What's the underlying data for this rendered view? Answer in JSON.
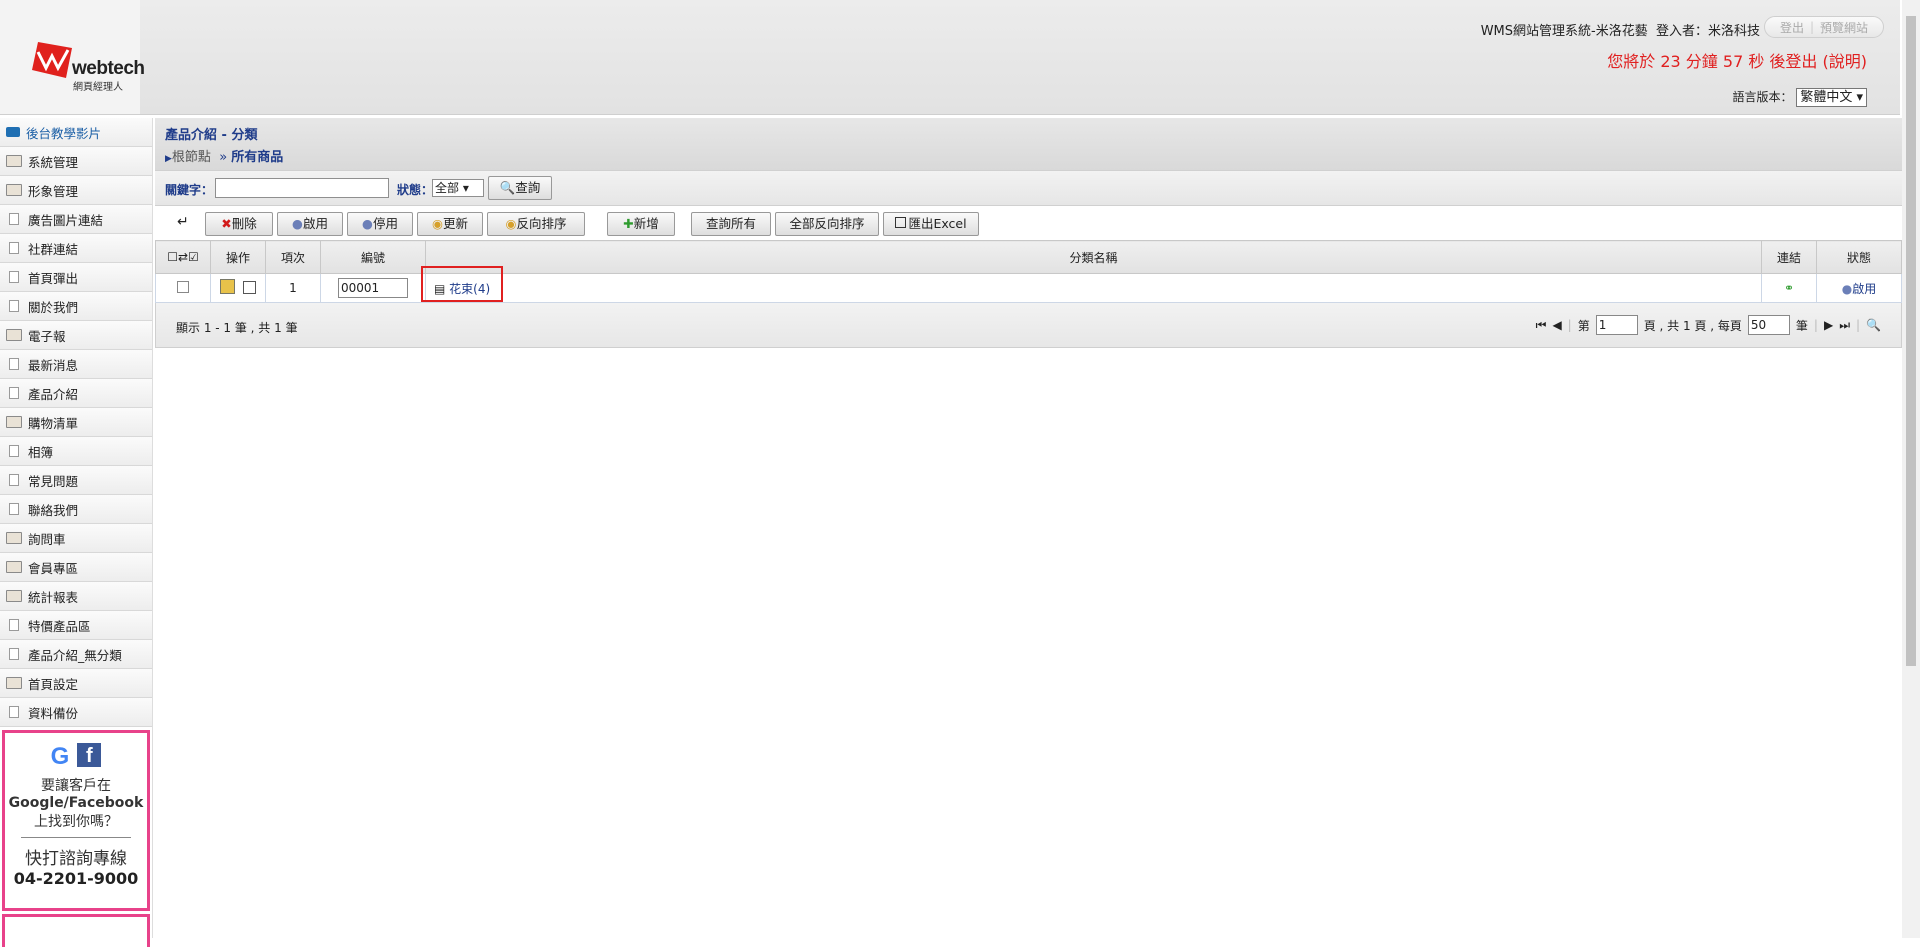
{
  "header": {
    "logo_text": "webtech",
    "logo_sub": "網頁經理人",
    "system_title": "WMS網站管理系統-米洛花藝",
    "login_label": "登入者：米洛科技",
    "logout_label": "登出",
    "preview_label": "預覽網站",
    "countdown": "您將於 23 分鐘 57 秒 後登出 (說明)",
    "lang_label": "語言版本：",
    "lang_value": "繁體中文"
  },
  "sidebar": {
    "items": [
      {
        "label": "後台教學影片",
        "icon": "video-icon"
      },
      {
        "label": "系統管理",
        "icon": "folder-icon"
      },
      {
        "label": "形象管理",
        "icon": "folder-icon"
      },
      {
        "label": "廣告圖片連結",
        "icon": "document-icon"
      },
      {
        "label": "社群連結",
        "icon": "document-icon"
      },
      {
        "label": "首頁彈出",
        "icon": "document-icon"
      },
      {
        "label": "關於我們",
        "icon": "document-icon"
      },
      {
        "label": "電子報",
        "icon": "folder-icon"
      },
      {
        "label": "最新消息",
        "icon": "document-icon"
      },
      {
        "label": "產品介紹",
        "icon": "document-icon"
      },
      {
        "label": "購物清單",
        "icon": "folder-icon"
      },
      {
        "label": "相簿",
        "icon": "document-icon"
      },
      {
        "label": "常見問題",
        "icon": "document-icon"
      },
      {
        "label": "聯絡我們",
        "icon": "document-icon"
      },
      {
        "label": "詢問車",
        "icon": "folder-icon"
      },
      {
        "label": "會員專區",
        "icon": "folder-icon"
      },
      {
        "label": "統計報表",
        "icon": "folder-icon"
      },
      {
        "label": "特價產品區",
        "icon": "document-icon"
      },
      {
        "label": "產品介紹_無分類",
        "icon": "document-icon"
      },
      {
        "label": "首頁設定",
        "icon": "folder-icon"
      },
      {
        "label": "資料備份",
        "icon": "document-icon"
      }
    ],
    "ad": {
      "line1": "要讓客戶在",
      "line2": "Google/Facebook",
      "line3": "上找到你嗎？",
      "line4": "快打諮詢專線",
      "phone": "04-2201-9000"
    }
  },
  "main": {
    "title": "產品介紹 - 分類",
    "breadcrumb_root": "根節點",
    "breadcrumb_current": "所有商品",
    "search": {
      "keyword_label": "關鍵字：",
      "keyword_value": "",
      "status_label": "狀態：",
      "status_value": "全部",
      "query_label": "查詢"
    },
    "toolbar": {
      "back_symbol": "↵",
      "delete_label": "刪除",
      "enable_label": "啟用",
      "disable_label": "停用",
      "update_label": "更新",
      "reverse_label": "反向排序",
      "add_label": "新增",
      "query_all_label": "查詢所有",
      "reverse_all_label": "全部反向排序",
      "export_label": "匯出Excel"
    },
    "table": {
      "columns": [
        "操作",
        "項次",
        "編號",
        "分類名稱",
        "連結",
        "狀態"
      ],
      "rows": [
        {
          "index": "1",
          "code": "00001",
          "name": "花束(4)",
          "status": "啟用"
        }
      ]
    },
    "pager": {
      "summary": "顯示 1 - 1 筆 , 共 1 筆",
      "page_prefix": "第",
      "page_value": "1",
      "page_mid": "頁 , 共 1 頁 , 每頁",
      "per_page_value": "50",
      "per_page_suffix": "筆"
    }
  },
  "colors": {
    "accent_blue": "#1f3c8a",
    "countdown_red": "#e02020",
    "ad_border": "#e8428a",
    "highlight_box": "#e02020"
  }
}
